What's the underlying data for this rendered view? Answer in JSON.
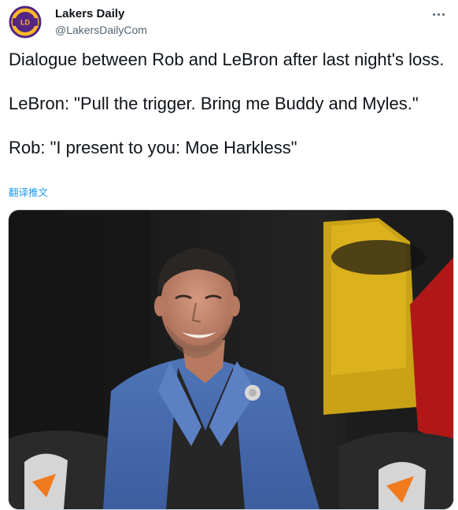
{
  "author": {
    "display_name": "Lakers Daily",
    "handle": "@LakersDailyCom",
    "avatar_icon": "lakers-daily-logo-icon"
  },
  "tweet": {
    "lines": [
      "Dialogue between Rob and LeBron after last night's loss.",
      "LeBron: \"Pull the trigger. Bring me Buddy and Myles.\"",
      "Rob: \"I present to you: Moe Harkless\""
    ],
    "translate_label": "翻译推文"
  },
  "media": {
    "type": "photo",
    "subject": "man-in-blue-blazer-courtside"
  },
  "colors": {
    "link": "#1d9bf0",
    "text": "#0f1419",
    "secondary": "#536471",
    "lakers_purple": "#552583",
    "lakers_gold": "#fdb927"
  }
}
